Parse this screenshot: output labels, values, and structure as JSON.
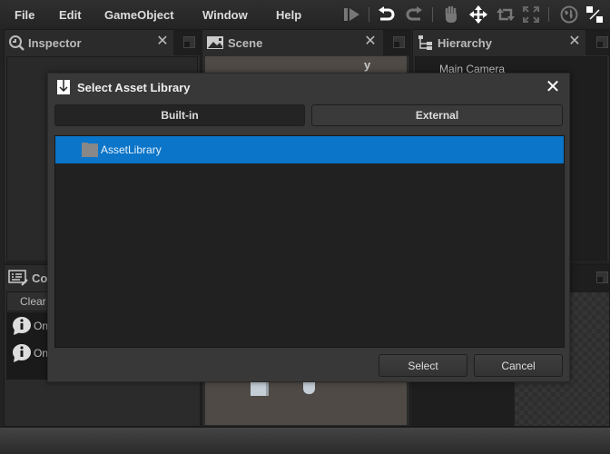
{
  "menu": {
    "items": [
      "File",
      "Edit",
      "GameObject",
      "Window",
      "Help"
    ]
  },
  "toolbar": {
    "icons": [
      "step-icon",
      "undo-icon",
      "redo-icon",
      "hand-icon",
      "move-icon",
      "rotate-icon",
      "scale-icon",
      "globe-icon",
      "pivot-icon"
    ]
  },
  "panels": {
    "inspector": {
      "title": "Inspector"
    },
    "scene": {
      "title": "Scene",
      "axis_label": "y"
    },
    "hierarchy": {
      "title": "Hierarchy",
      "items": [
        "Main Camera"
      ]
    },
    "console": {
      "title": "Console",
      "title_visible": "Cor",
      "clear_label": "Clear",
      "messages": [
        "On",
        "On"
      ]
    }
  },
  "dialog": {
    "title": "Select Asset Library",
    "tabs": [
      {
        "label": "Built-in",
        "active": true
      },
      {
        "label": "External",
        "active": false
      }
    ],
    "items": [
      {
        "label": "AssetLibrary",
        "selected": true
      }
    ],
    "select_label": "Select",
    "cancel_label": "Cancel",
    "selection_color": "#0a75c9"
  }
}
